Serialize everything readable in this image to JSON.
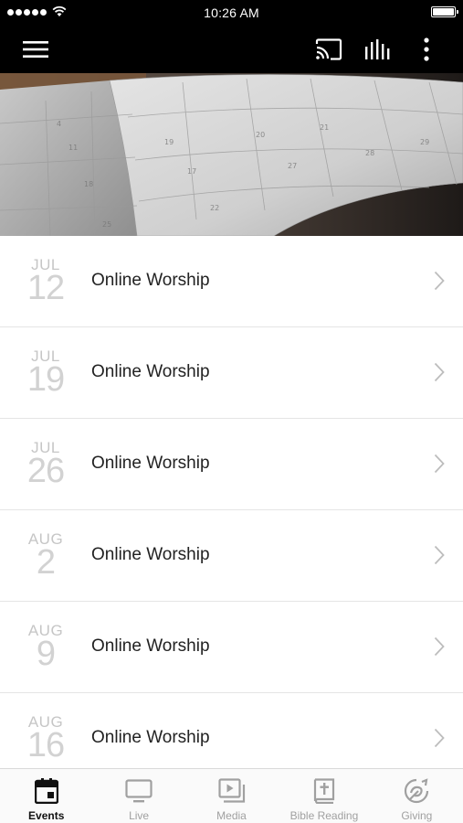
{
  "status_bar": {
    "time": "10:26 AM"
  },
  "app_bar": {
    "icons": [
      "menu-icon",
      "cast-icon",
      "stats-icon",
      "more-vertical-icon"
    ]
  },
  "events": [
    {
      "month": "JUL",
      "day": "12",
      "title": "Online Worship"
    },
    {
      "month": "JUL",
      "day": "19",
      "title": "Online Worship"
    },
    {
      "month": "JUL",
      "day": "26",
      "title": "Online Worship"
    },
    {
      "month": "AUG",
      "day": "2",
      "title": "Online Worship"
    },
    {
      "month": "AUG",
      "day": "9",
      "title": "Online Worship"
    },
    {
      "month": "AUG",
      "day": "16",
      "title": "Online Worship"
    }
  ],
  "tab_bar": {
    "tabs": [
      {
        "label": "Events",
        "icon": "calendar-icon",
        "active": true
      },
      {
        "label": "Live",
        "icon": "tv-icon",
        "active": false
      },
      {
        "label": "Media",
        "icon": "media-icon",
        "active": false
      },
      {
        "label": "Bible Reading",
        "icon": "bible-icon",
        "active": false
      },
      {
        "label": "Giving",
        "icon": "giving-icon",
        "active": false
      }
    ]
  },
  "colors": {
    "bar_background": "#000000",
    "tab_active": "#111111",
    "tab_inactive": "#a0a0a0",
    "date_text": "#c6c6c6"
  }
}
